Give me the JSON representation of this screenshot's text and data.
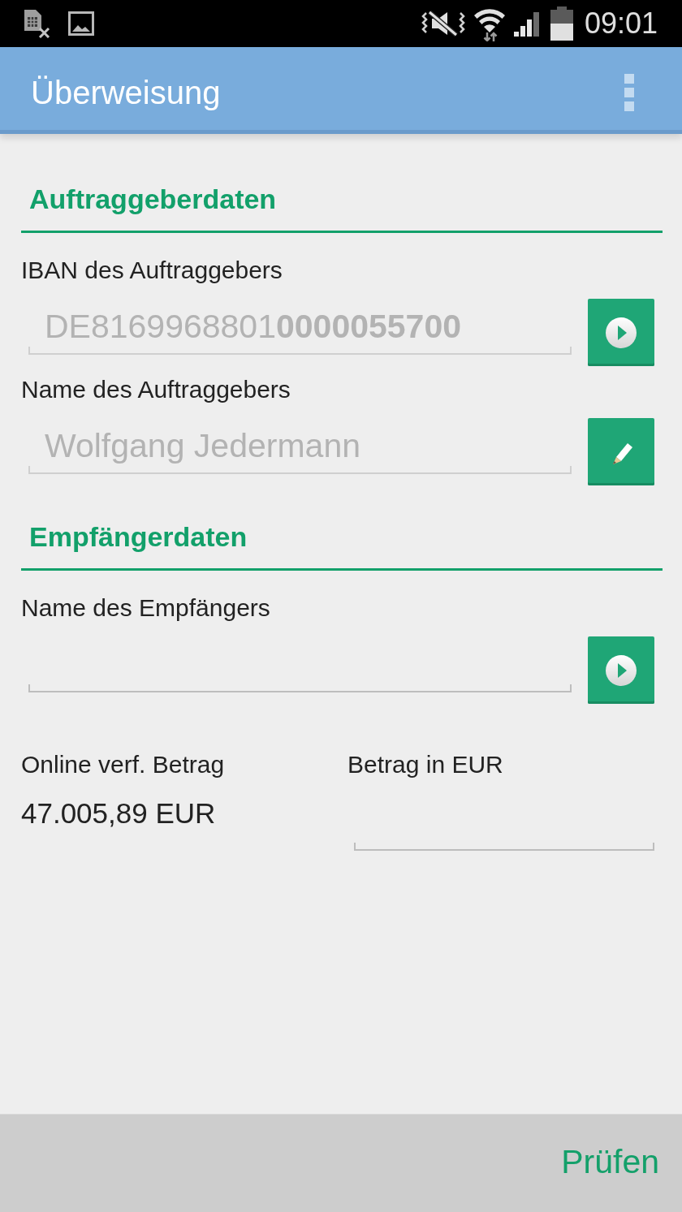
{
  "status_bar": {
    "time": "09:01"
  },
  "app_bar": {
    "title": "Überweisung"
  },
  "sections": [
    {
      "title": "Auftraggeberdaten",
      "fields": [
        {
          "label": "IBAN des Auftraggebers",
          "value": "DE8169968801**0000055700**",
          "disabled": true,
          "kind": "select"
        },
        {
          "label": "Name des Auftraggebers",
          "value": "Wolfgang Jedermann",
          "disabled": true,
          "kind": "edit"
        }
      ]
    },
    {
      "title": "Empfängerdaten",
      "fields": [
        {
          "label": "Name des Empfängers",
          "disabled": false,
          "kind": "select"
        }
      ]
    }
  ],
  "amounts": {
    "available": {
      "label": "Online verf. Betrag",
      "value": "47.005,89 EUR"
    },
    "transfer": {
      "label": "Betrag in EUR"
    }
  },
  "bottom_bar": {
    "button": "Prüfen"
  }
}
